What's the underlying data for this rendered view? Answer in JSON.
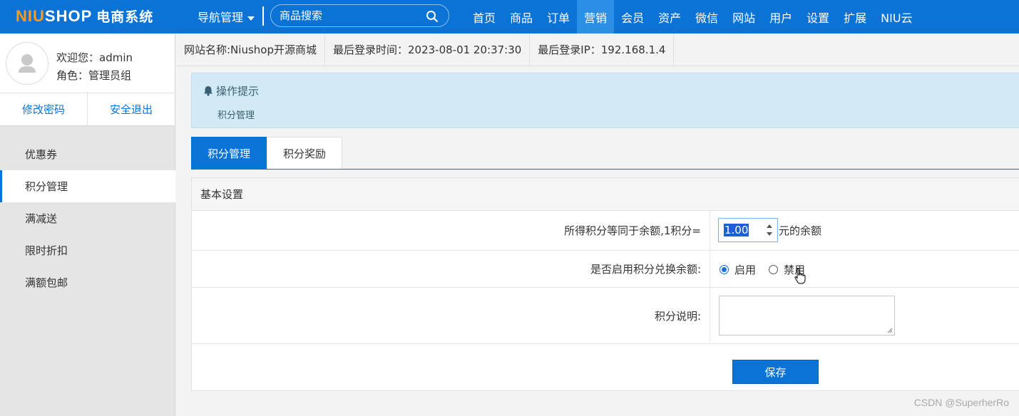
{
  "brand": {
    "logo_main": "NIUSHOP",
    "logo_accent": "NIU",
    "logo_rest": "SHOP",
    "logo_cn": "电商系统",
    "accent_color": "#ff9a1f",
    "bar_color": "#0b73d6"
  },
  "header": {
    "nav_manage_label": "导航管理",
    "search": {
      "placeholder": "商品搜索"
    },
    "menu": [
      "首页",
      "商品",
      "订单",
      "营销",
      "会员",
      "资产",
      "微信",
      "网站",
      "用户",
      "设置",
      "扩展",
      "NIU云"
    ],
    "active_menu": "营销"
  },
  "user": {
    "welcome": "欢迎您：admin",
    "role": "角色：管理员组",
    "change_password": "修改密码",
    "logout": "安全退出"
  },
  "sidebar": {
    "items": [
      "优惠券",
      "积分管理",
      "满减送",
      "限时折扣",
      "满额包邮"
    ],
    "active": "积分管理"
  },
  "infobar": {
    "site_name": "网站名称:Niushop开源商城",
    "last_login_time": "最后登录时间：2023-08-01 20:37:30",
    "last_login_ip": "最后登录IP：192.168.1.4"
  },
  "tip": {
    "title": "操作提示",
    "text": "积分管理"
  },
  "tabs": {
    "items": [
      "积分管理",
      "积分奖励"
    ],
    "active": "积分管理"
  },
  "form": {
    "section_title": "基本设置",
    "rate_label": "所得积分等同于余额,1积分=",
    "rate_value": "1.00",
    "rate_unit": "元的余额",
    "enable_label": "是否启用积分兑换余额:",
    "enable_options": [
      "启用",
      "禁用"
    ],
    "enable_selected": "启用",
    "desc_label": "积分说明:",
    "desc_value": "",
    "save_label": "保存"
  },
  "watermark": "CSDN @SuperherRo"
}
